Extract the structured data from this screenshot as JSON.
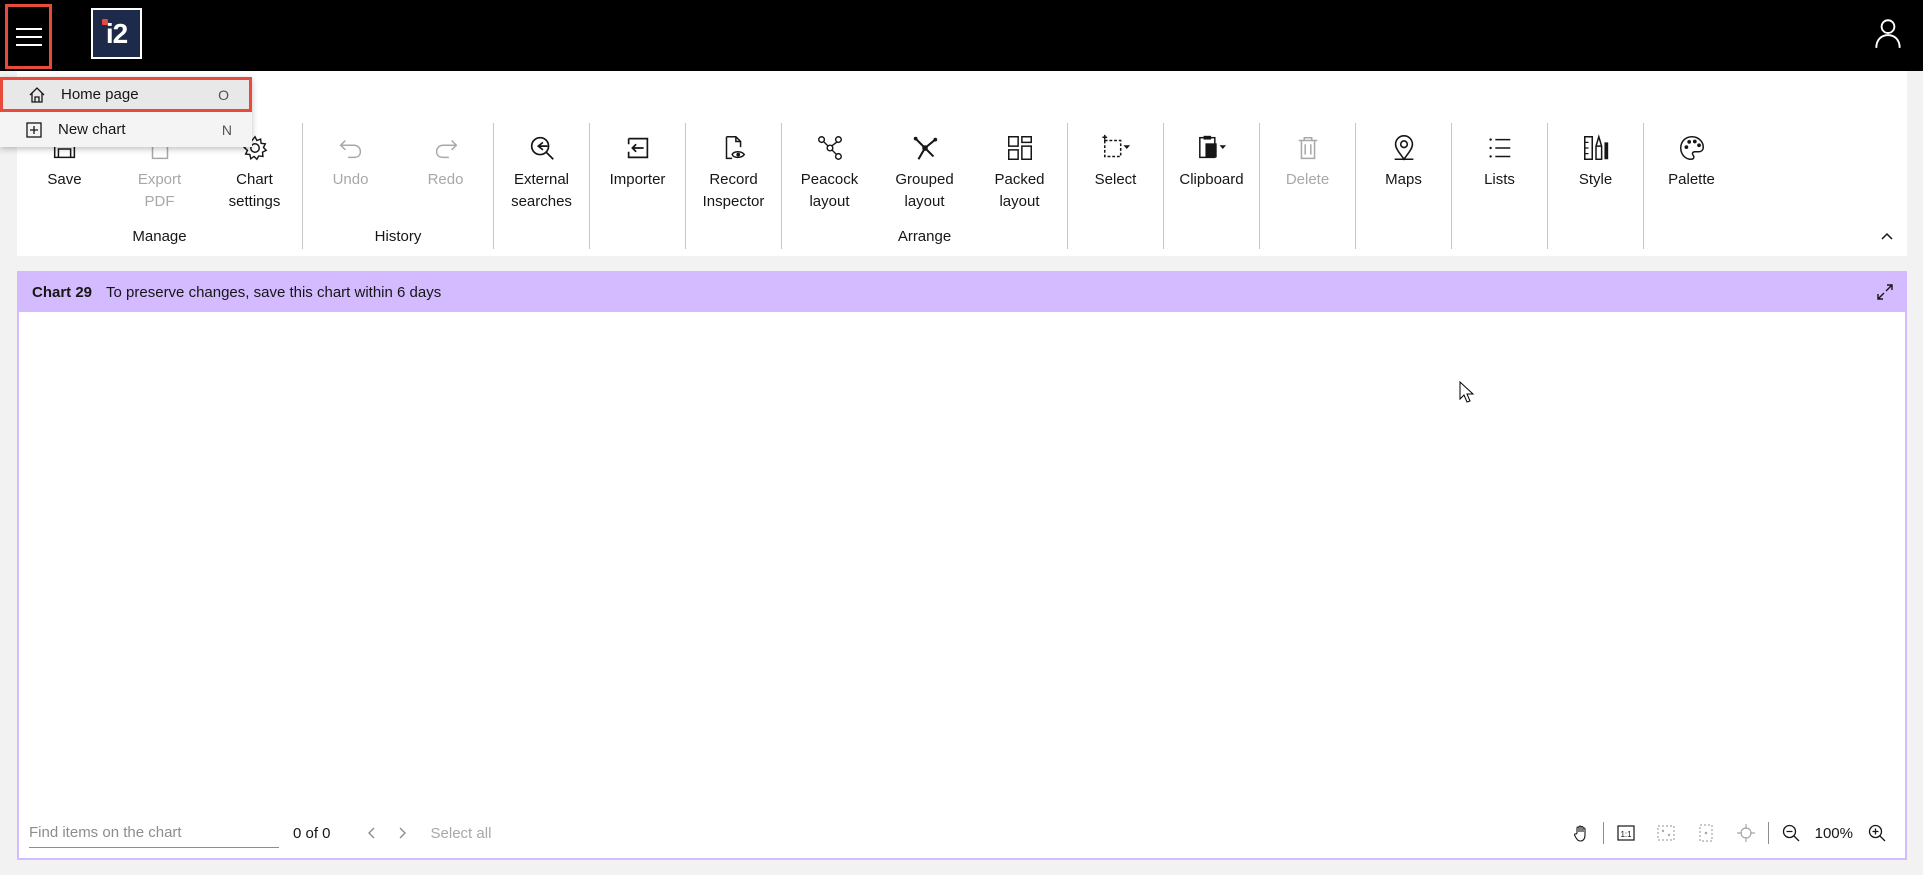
{
  "app": {
    "logo_text": "i2"
  },
  "menu": {
    "items": [
      {
        "label": "Home page",
        "shortcut": "O",
        "icon": "home-icon"
      },
      {
        "label": "New chart",
        "shortcut": "N",
        "icon": "add-square-icon"
      }
    ]
  },
  "ribbon": {
    "groups": [
      {
        "label": "Manage",
        "buttons": [
          {
            "label": "Save",
            "icon": "save-icon",
            "disabled": false
          },
          {
            "label": "Export\nPDF",
            "icon": "export-pdf-icon",
            "disabled": true
          },
          {
            "label": "Chart\nsettings",
            "icon": "gear-icon",
            "disabled": false
          }
        ]
      },
      {
        "label": "History",
        "buttons": [
          {
            "label": "Undo",
            "icon": "undo-icon",
            "disabled": true
          },
          {
            "label": "Redo",
            "icon": "redo-icon",
            "disabled": true
          }
        ]
      },
      {
        "label": "",
        "buttons": [
          {
            "label": "External\nsearches",
            "icon": "external-search-icon",
            "disabled": false
          }
        ]
      },
      {
        "label": "",
        "buttons": [
          {
            "label": "Importer",
            "icon": "importer-icon",
            "disabled": false
          }
        ]
      },
      {
        "label": "",
        "buttons": [
          {
            "label": "Record\nInspector",
            "icon": "record-inspector-icon",
            "disabled": false
          }
        ]
      },
      {
        "label": "Arrange",
        "buttons": [
          {
            "label": "Peacock\nlayout",
            "icon": "peacock-layout-icon",
            "disabled": false
          },
          {
            "label": "Grouped\nlayout",
            "icon": "grouped-layout-icon",
            "disabled": false
          },
          {
            "label": "Packed\nlayout",
            "icon": "packed-layout-icon",
            "disabled": false
          }
        ]
      },
      {
        "label": "",
        "buttons": [
          {
            "label": "Select",
            "icon": "select-icon",
            "disabled": false
          }
        ]
      },
      {
        "label": "",
        "buttons": [
          {
            "label": "Clipboard",
            "icon": "clipboard-icon",
            "disabled": false
          }
        ]
      },
      {
        "label": "",
        "buttons": [
          {
            "label": "Delete",
            "icon": "trash-icon",
            "disabled": true
          }
        ]
      },
      {
        "label": "",
        "buttons": [
          {
            "label": "Maps",
            "icon": "map-pin-icon",
            "disabled": false
          }
        ]
      },
      {
        "label": "",
        "buttons": [
          {
            "label": "Lists",
            "icon": "list-icon",
            "disabled": false
          }
        ]
      },
      {
        "label": "",
        "buttons": [
          {
            "label": "Style",
            "icon": "style-icon",
            "disabled": false
          }
        ]
      },
      {
        "label": "",
        "buttons": [
          {
            "label": "Palette",
            "icon": "palette-icon",
            "disabled": false
          }
        ]
      }
    ]
  },
  "chart": {
    "title": "Chart 29",
    "notice": "To preserve changes, save this chart within 6 days",
    "header_color": "#d4bbff"
  },
  "footer": {
    "find_placeholder": "Find items on the chart",
    "count": "0 of 0",
    "select_all": "Select all",
    "zoom": "100%"
  },
  "colors": {
    "highlight": "#e84a3c",
    "topbar": "#000000",
    "chart_header": "#d4bbff"
  }
}
